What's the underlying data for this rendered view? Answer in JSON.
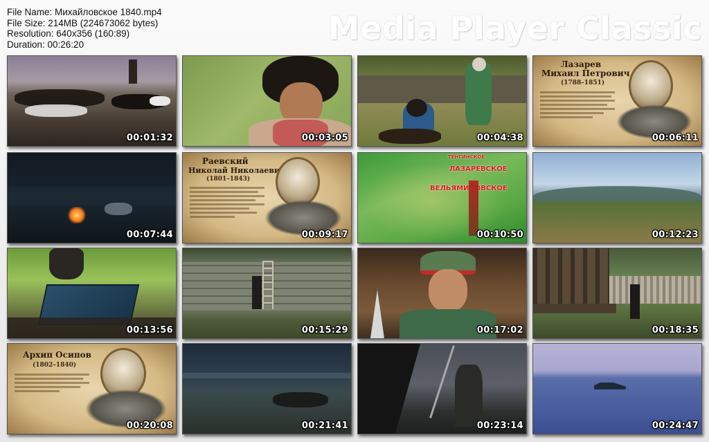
{
  "file_info": {
    "file_name_line": "File Name: Михайловское 1840.mp4",
    "file_size_line": "File Size: 214MB (224673062 bytes)",
    "resolution_line": "Resolution: 640x356 (160:89)",
    "duration_line": "Duration: 00:26:20"
  },
  "brand": {
    "text": "Media Player Classic"
  },
  "thumbnails": [
    {
      "time": "00:01:32"
    },
    {
      "time": "00:03:05"
    },
    {
      "time": "00:04:38"
    },
    {
      "time": "00:06:11",
      "portrait": {
        "surname": "Лазарев",
        "fullname": "Михаил Петрович",
        "years": "(1788–1851)"
      }
    },
    {
      "time": "00:07:44"
    },
    {
      "time": "00:09:17",
      "portrait": {
        "surname": "Раевский",
        "fullname": "Николай Николаевич",
        "years": "(1801–1843)"
      }
    },
    {
      "time": "00:10:50",
      "map": {
        "labels": [
          "ТЕНГИНСКОЕ",
          "ЛАЗАРЕВСКОЕ",
          "ВЕЛЬЯМИНОВСКОЕ"
        ]
      }
    },
    {
      "time": "00:12:23"
    },
    {
      "time": "00:13:56"
    },
    {
      "time": "00:15:29"
    },
    {
      "time": "00:17:02"
    },
    {
      "time": "00:18:35"
    },
    {
      "time": "00:20:08",
      "portrait": {
        "surname": "Архип Осипов",
        "fullname": "",
        "years": "(1802–1840)"
      }
    },
    {
      "time": "00:21:41"
    },
    {
      "time": "00:23:14"
    },
    {
      "time": "00:24:47"
    }
  ],
  "colors": {
    "background": "#f0f0f0",
    "timestamp_text": "#ffffff",
    "brand_text": "#ffffff"
  }
}
